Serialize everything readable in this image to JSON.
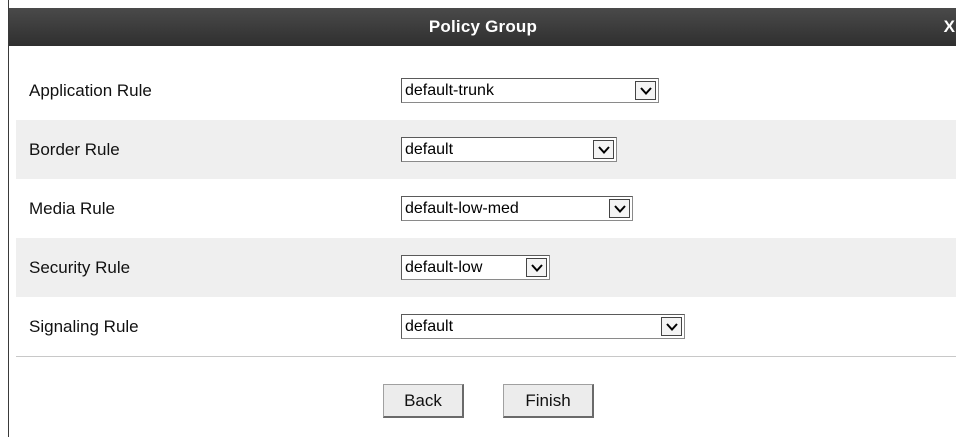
{
  "dialog": {
    "title": "Policy Group",
    "close_label": "X"
  },
  "rules": [
    {
      "label": "Application Rule",
      "value": "default-trunk"
    },
    {
      "label": "Border Rule",
      "value": "default"
    },
    {
      "label": "Media Rule",
      "value": "default-low-med"
    },
    {
      "label": "Security Rule",
      "value": "default-low"
    },
    {
      "label": "Signaling Rule",
      "value": "default"
    }
  ],
  "buttons": {
    "back_label": "Back",
    "finish_label": "Finish"
  }
}
